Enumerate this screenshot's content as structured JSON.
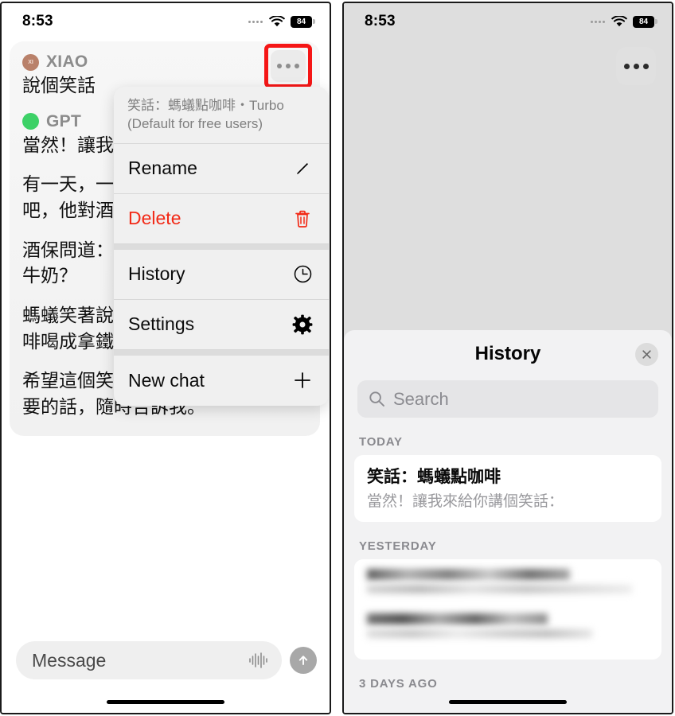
{
  "status_bar": {
    "time": "8:53",
    "battery": "84",
    "wifi_icon": "wifi-icon",
    "cellular_icon": "cellular-dots-icon"
  },
  "left_phone": {
    "more_button_icon": "ellipsis-icon",
    "highlight_color": "#f51616",
    "messages": [
      {
        "author": "XIAO",
        "avatar_initials": "XI",
        "avatar_color": "#b9816a",
        "text": "說個笑話"
      },
      {
        "author": "GPT",
        "avatar_initials": "",
        "avatar_color": "#3dd167",
        "text": "當然！讓我來給你講個笑話："
      }
    ],
    "body_paragraphs": [
      "有一天，一隻螞蟻走進了一間酒吧，他對酒保說：我要一杯咖啡。",
      "酒保問道：你確定嗎？要不要加點牛奶？",
      "螞蟻笑著說：不用了，我怕我把咖啡喝成拿鐵了！",
      "希望這個笑話讓你開心！有其他需要的話，隨時告訴我。"
    ],
    "composer": {
      "placeholder": "Message",
      "waveform_icon": "waveform-icon",
      "send_icon": "arrow-up-icon"
    },
    "menu": {
      "header_line1": "笑話：螞蟻點咖啡・Turbo",
      "header_line2": "(Default for free users)",
      "items": [
        {
          "label": "Rename",
          "icon": "pencil-icon",
          "danger": false
        },
        {
          "label": "Delete",
          "icon": "trash-icon",
          "danger": true
        },
        {
          "label": "History",
          "icon": "clock-icon",
          "danger": false
        },
        {
          "label": "Settings",
          "icon": "gear-icon",
          "danger": false
        },
        {
          "label": "New chat",
          "icon": "plus-icon",
          "danger": false
        }
      ]
    }
  },
  "right_phone": {
    "more_button_icon": "ellipsis-icon",
    "sheet": {
      "title": "History",
      "close_icon": "close-x-icon",
      "search": {
        "placeholder": "Search",
        "icon": "search-icon"
      },
      "sections": [
        {
          "label": "TODAY",
          "items": [
            {
              "title": "笑話：螞蟻點咖啡",
              "subtitle": "當然！讓我來給你講個笑話：",
              "redacted": false
            }
          ]
        },
        {
          "label": "YESTERDAY",
          "items": [
            {
              "title": "",
              "subtitle": "",
              "redacted": true
            },
            {
              "title": "",
              "subtitle": "",
              "redacted": true
            }
          ]
        },
        {
          "label": "3 DAYS AGO",
          "items": []
        }
      ]
    }
  }
}
